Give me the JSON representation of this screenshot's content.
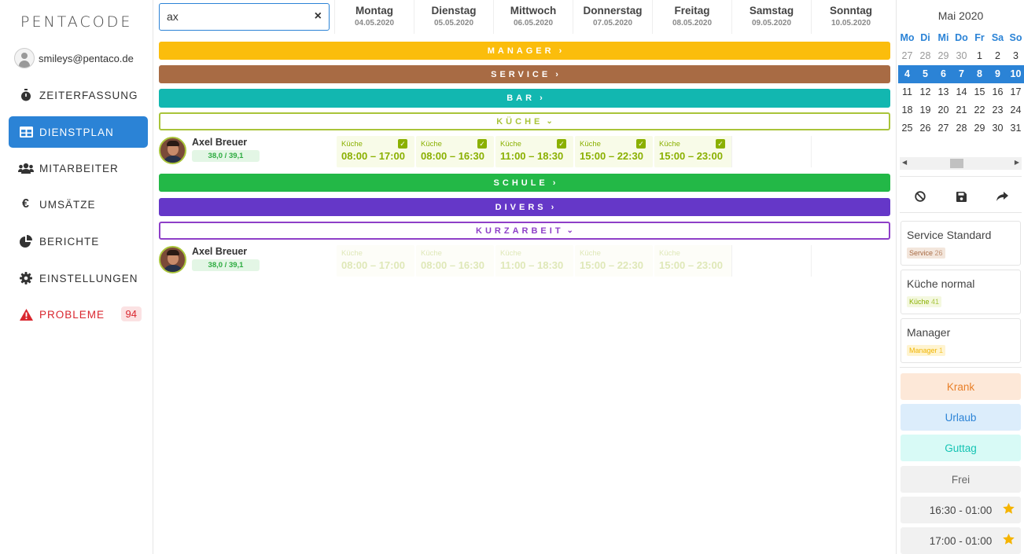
{
  "app": {
    "logo": "PENTACODE"
  },
  "user": {
    "email": "smileys@pentaco.de"
  },
  "nav": [
    {
      "label": "ZEITERFASSUNG",
      "icon": "stopwatch-icon"
    },
    {
      "label": "DIENSTPLAN",
      "icon": "table-icon",
      "active": true
    },
    {
      "label": "MITARBEITER",
      "icon": "users-icon"
    },
    {
      "label": "UMSÄTZE",
      "icon": "euro-icon"
    },
    {
      "label": "BERICHTE",
      "icon": "pie-chart-icon"
    },
    {
      "label": "EINSTELLUNGEN",
      "icon": "gear-icon"
    },
    {
      "label": "PROBLEME",
      "icon": "warning-icon",
      "badge": "94"
    }
  ],
  "search": {
    "value": "ax",
    "clear": "×"
  },
  "days": [
    {
      "name": "Montag",
      "date": "04.05.2020"
    },
    {
      "name": "Dienstag",
      "date": "05.05.2020"
    },
    {
      "name": "Mittwoch",
      "date": "06.05.2020"
    },
    {
      "name": "Donnerstag",
      "date": "07.05.2020"
    },
    {
      "name": "Freitag",
      "date": "08.05.2020"
    },
    {
      "name": "Samstag",
      "date": "09.05.2020"
    },
    {
      "name": "Sonntag",
      "date": "10.05.2020"
    }
  ],
  "groups": {
    "manager": {
      "label": "MANAGER",
      "color": "#fbbd0c"
    },
    "service": {
      "label": "SERVICE",
      "color": "#a86b44"
    },
    "bar": {
      "label": "BAR",
      "color": "#12b7b0"
    },
    "kueche": {
      "label": "KÜCHE",
      "color": "#a9c43a"
    },
    "schule": {
      "label": "SCHULE",
      "color": "#23b847"
    },
    "divers": {
      "label": "DIVERS",
      "color": "#6537c8"
    },
    "kurzarbeit": {
      "label": "KURZARBEIT",
      "color": "#8e3fc8"
    }
  },
  "employees": [
    {
      "name": "Axel Breuer",
      "hours": "38,0 / 39,1"
    },
    {
      "name": "Axel Breuer",
      "hours": "38,0 / 39,1"
    }
  ],
  "shifts": [
    {
      "label": "Küche",
      "time": "08:00 – 17:00"
    },
    {
      "label": "Küche",
      "time": "08:00 – 16:30"
    },
    {
      "label": "Küche",
      "time": "11:00 – 18:30"
    },
    {
      "label": "Küche",
      "time": "15:00 – 22:30"
    },
    {
      "label": "Küche",
      "time": "15:00 – 23:00"
    }
  ],
  "calendar": {
    "month": "Mai",
    "year": "2020",
    "weekdays": [
      "Mo",
      "Di",
      "Mi",
      "Do",
      "Fr",
      "Sa",
      "So"
    ],
    "weeks": [
      [
        "27",
        "28",
        "29",
        "30",
        "1",
        "2",
        "3"
      ],
      [
        "4",
        "5",
        "6",
        "7",
        "8",
        "9",
        "10"
      ],
      [
        "11",
        "12",
        "13",
        "14",
        "15",
        "16",
        "17"
      ],
      [
        "18",
        "19",
        "20",
        "21",
        "22",
        "23",
        "24"
      ],
      [
        "25",
        "26",
        "27",
        "28",
        "29",
        "30",
        "31"
      ]
    ]
  },
  "templates": [
    {
      "title": "Service Standard",
      "tag": "Service",
      "count": "26",
      "color": "#a86b44"
    },
    {
      "title": "Küche normal",
      "tag": "Küche",
      "count": "41",
      "color": "#a9c43a"
    },
    {
      "title": "Manager",
      "tag": "Manager",
      "count": "1",
      "color": "#fbbd0c"
    }
  ],
  "absences": [
    {
      "label": "Krank",
      "bg": "#fde8d8",
      "fg": "#e8802a"
    },
    {
      "label": "Urlaub",
      "bg": "#dcedfb",
      "fg": "#2b83d6"
    },
    {
      "label": "Guttag",
      "bg": "#d8faf6",
      "fg": "#14c3b3"
    },
    {
      "label": "Frei",
      "bg": "#f1f1f1",
      "fg": "#666"
    }
  ],
  "favorites": [
    {
      "label": "16:30 - 01:00"
    },
    {
      "label": "17:00 - 01:00"
    }
  ]
}
